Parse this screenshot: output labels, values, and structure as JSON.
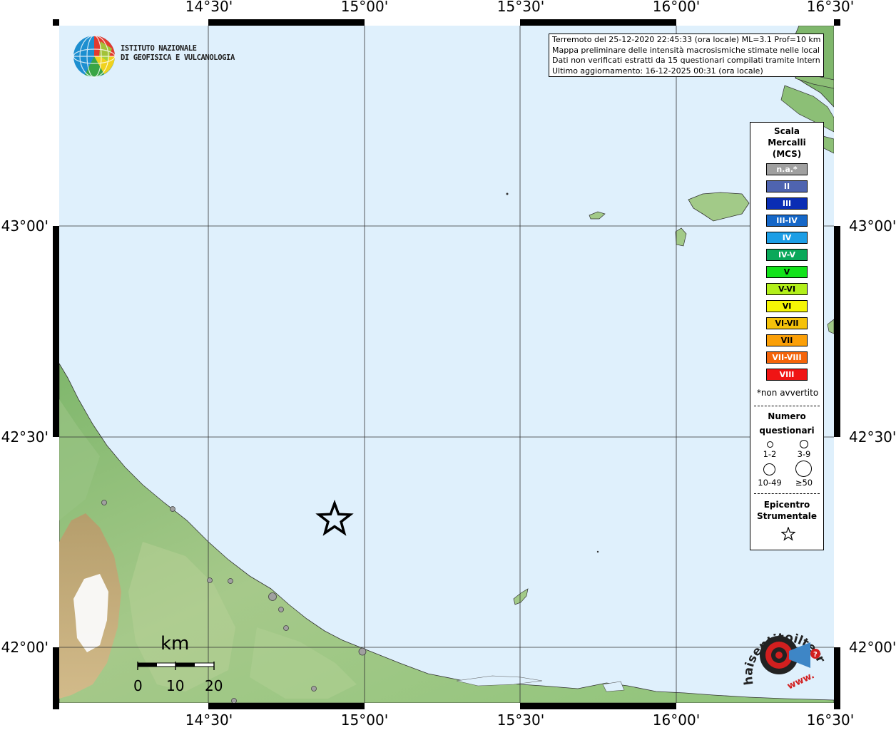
{
  "map": {
    "lon_labels": [
      "14°30'",
      "15°00'",
      "15°30'",
      "16°00'",
      "16°30'"
    ],
    "lat_labels": [
      "43°00'",
      "42°30'",
      "42°00'"
    ]
  },
  "logo": {
    "line1": "ISTITUTO NAZIONALE",
    "line2": "DI GEOFISICA E VULCANOLOGIA"
  },
  "info": {
    "line1": "Terremoto del 25-12-2020 22:45:33 (ora locale) ML=3.1 Prof=10 km",
    "line2": "Mappa preliminare delle intensità macrosismiche stimate nelle località",
    "line3": "Dati non verificati estratti da 15 questionari compilati tramite Internet.",
    "line4": "Ultimo aggiornamento: 16-12-2025 00:31 (ora locale)"
  },
  "legend": {
    "title_1": "Scala",
    "title_2": "Mercalli",
    "title_3": "(MCS)",
    "scale": [
      {
        "label": "n.a.*",
        "color": "#a0a0a0"
      },
      {
        "label": "II",
        "color": "#4f64b0"
      },
      {
        "label": "III",
        "color": "#0a2db4"
      },
      {
        "label": "III-IV",
        "color": "#1567c8"
      },
      {
        "label": "IV",
        "color": "#1c9ee6"
      },
      {
        "label": "IV-V",
        "color": "#0aa85a"
      },
      {
        "label": "V",
        "color": "#12e21a"
      },
      {
        "label": "V-VI",
        "color": "#b2ef1a"
      },
      {
        "label": "VI",
        "color": "#f5f505"
      },
      {
        "label": "VI-VII",
        "color": "#f5c20a"
      },
      {
        "label": "VII",
        "color": "#fb9f07"
      },
      {
        "label": "VII-VIII",
        "color": "#f4640a"
      },
      {
        "label": "VIII",
        "color": "#f01414"
      }
    ],
    "note": "*non avvertito",
    "count_title_1": "Numero",
    "count_title_2": "questionari",
    "counts": [
      "1-2",
      "3-9",
      "10-49",
      "≥50"
    ],
    "epi_title_1": "Epicentro",
    "epi_title_2": "Strumentale"
  },
  "scale_bar": {
    "unit": "km",
    "ticks": [
      "0",
      "10",
      "20"
    ]
  },
  "hst_logo": {
    "text": "haisentitoilterremoto.it",
    "www": "www."
  },
  "colors": {
    "sea": "#dff0fc",
    "land_low": "#8fc47a",
    "land_high": "#c9a774",
    "frame": "#000000"
  }
}
